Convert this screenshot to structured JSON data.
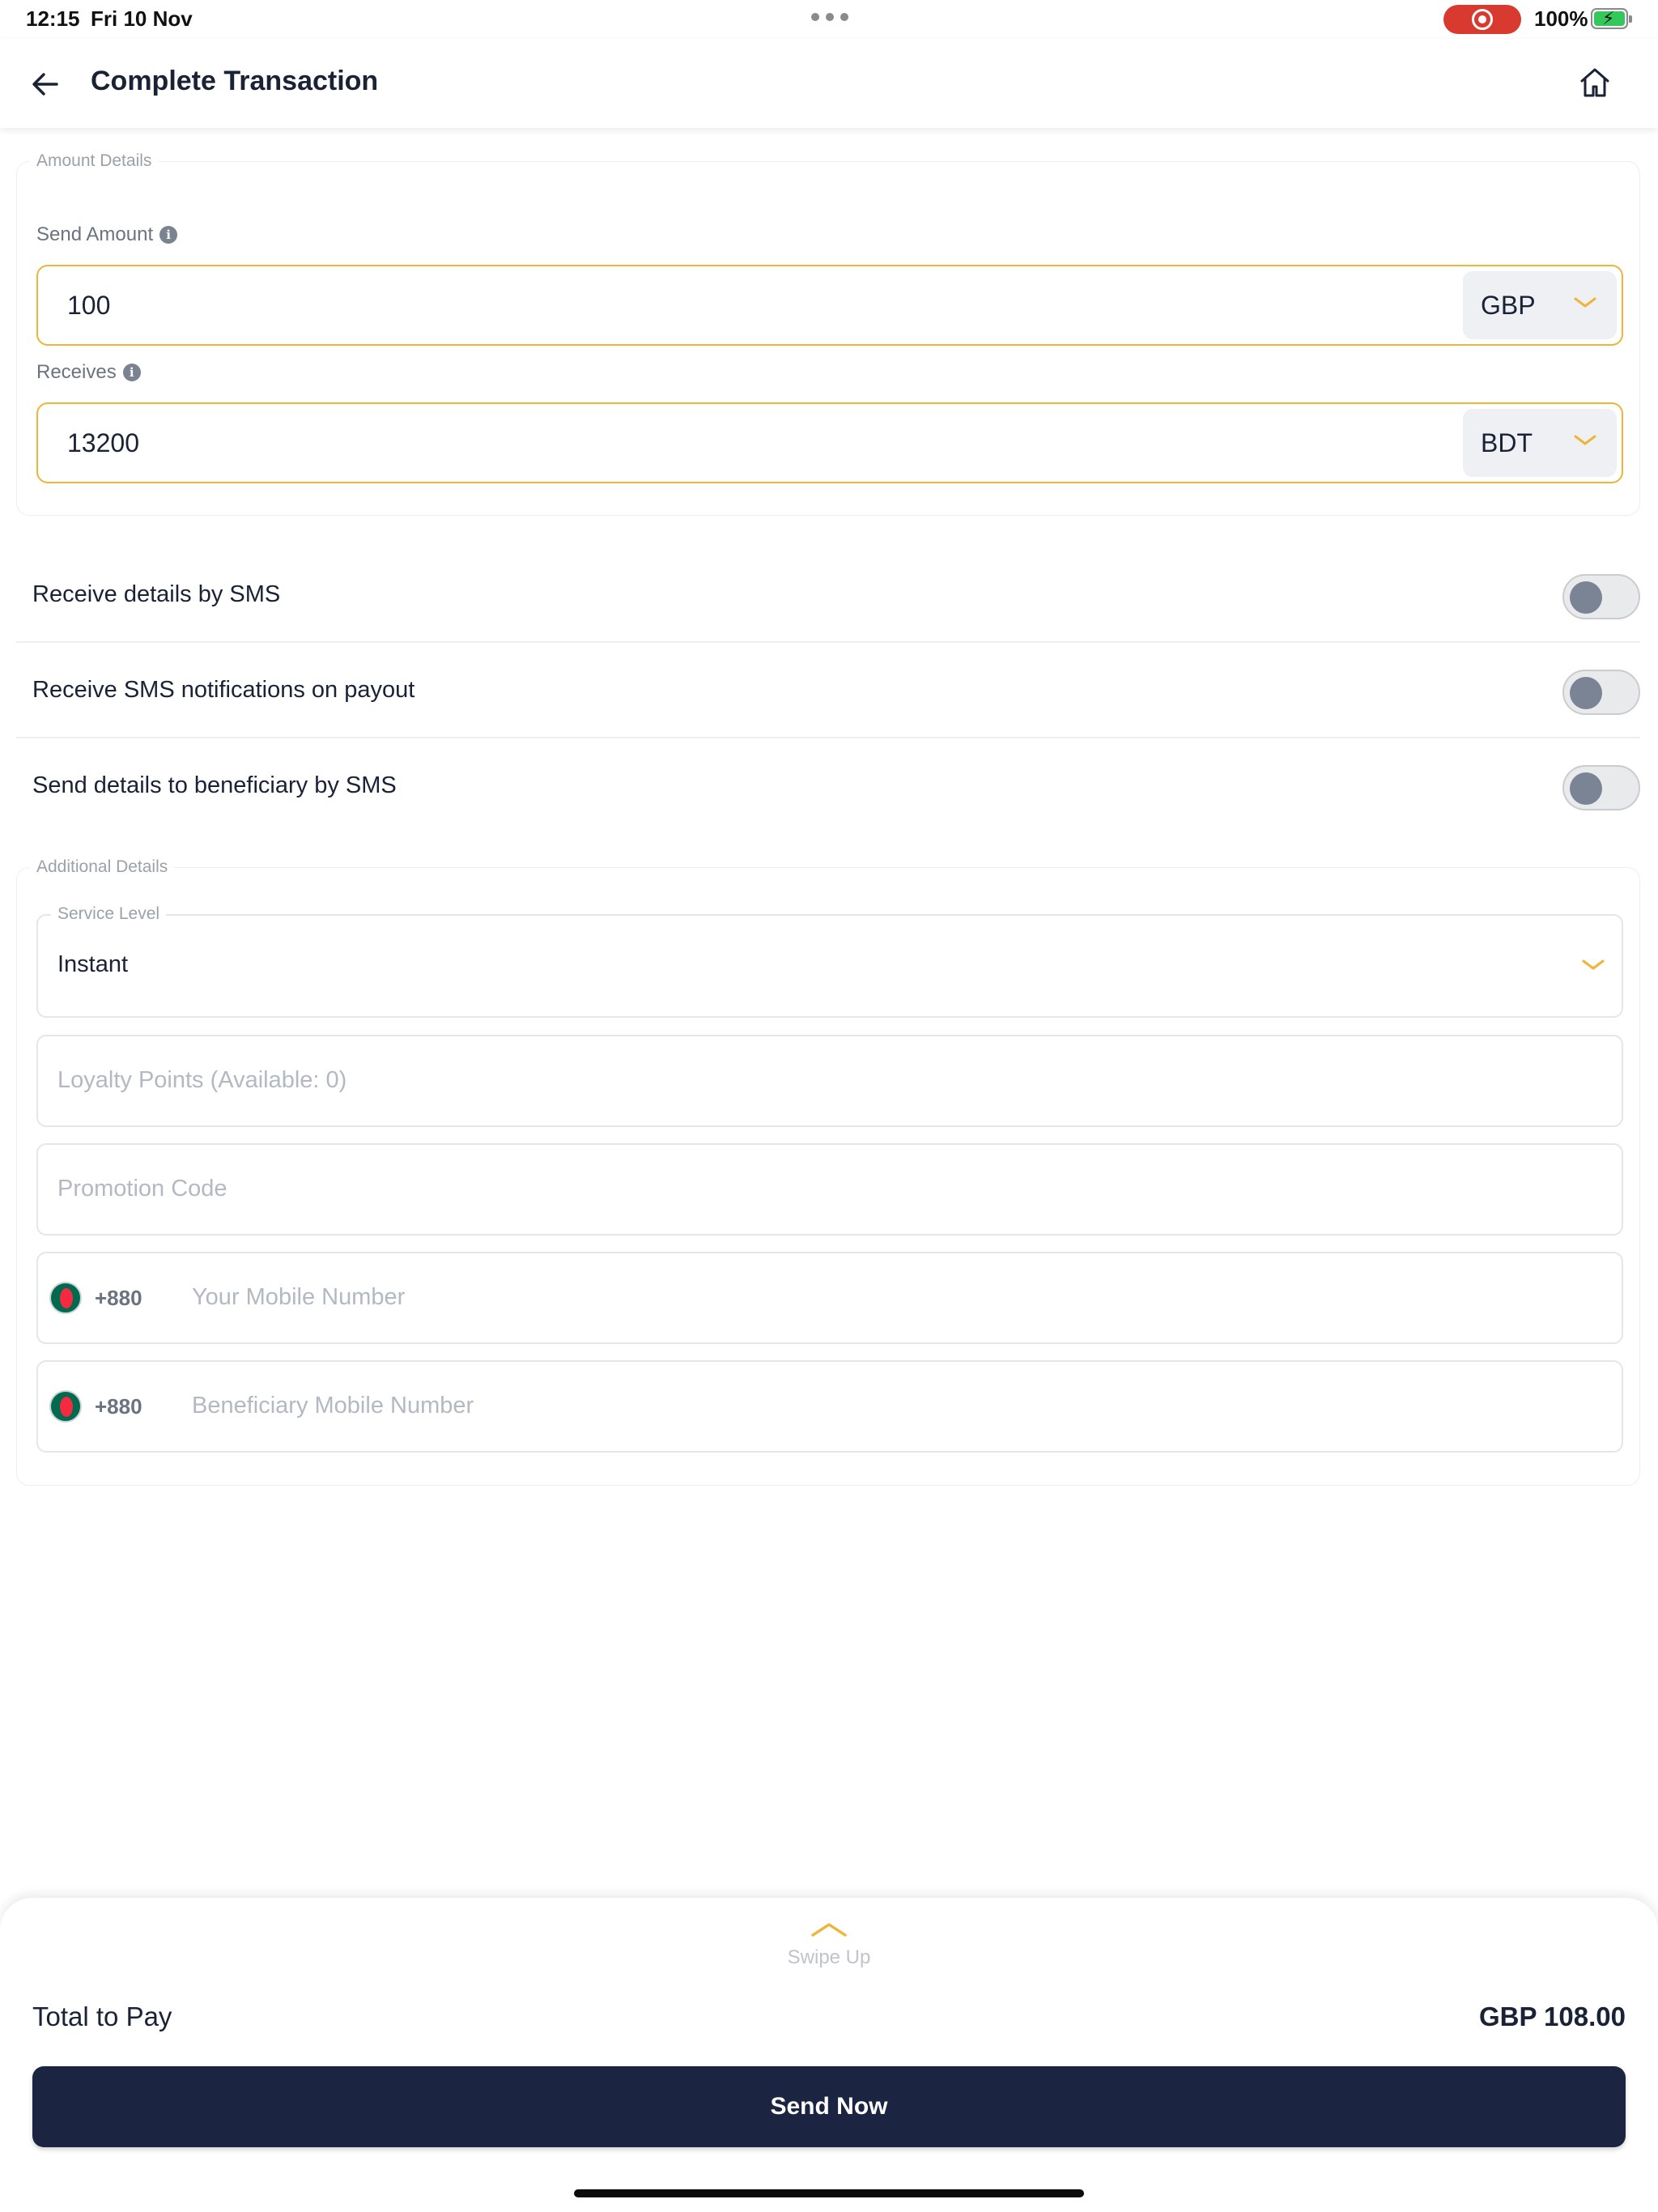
{
  "status_bar": {
    "time": "12:15",
    "date": "Fri 10 Nov",
    "battery": "100%"
  },
  "header": {
    "title": "Complete Transaction"
  },
  "amount_details": {
    "legend": "Amount Details",
    "send_label": "Send Amount",
    "send_value": "100",
    "send_currency": "GBP",
    "receive_label": "Receives",
    "receive_value": "13200",
    "receive_currency": "BDT"
  },
  "toggles": [
    {
      "label": "Receive details by SMS",
      "on": false
    },
    {
      "label": "Receive SMS notifications on payout",
      "on": false
    },
    {
      "label": "Send details to beneficiary by SMS",
      "on": false
    }
  ],
  "additional_details": {
    "legend": "Additional Details",
    "service_level_label": "Service Level",
    "service_level_value": "Instant",
    "loyalty_placeholder": "Loyalty Points (Available: 0)",
    "promo_placeholder": "Promotion Code",
    "mobile_code": "+880",
    "mobile_placeholder": "Your Mobile Number",
    "beneficiary_code": "+880",
    "beneficiary_placeholder": "Beneficiary Mobile Number"
  },
  "footer": {
    "swipe_text": "Swipe Up",
    "total_label": "Total to Pay",
    "total_value": "GBP 108.00",
    "send_button": "Send Now"
  },
  "colors": {
    "accent": "#efb43a",
    "primary_button": "#1b2440",
    "toggle_knob": "#7a8494"
  }
}
